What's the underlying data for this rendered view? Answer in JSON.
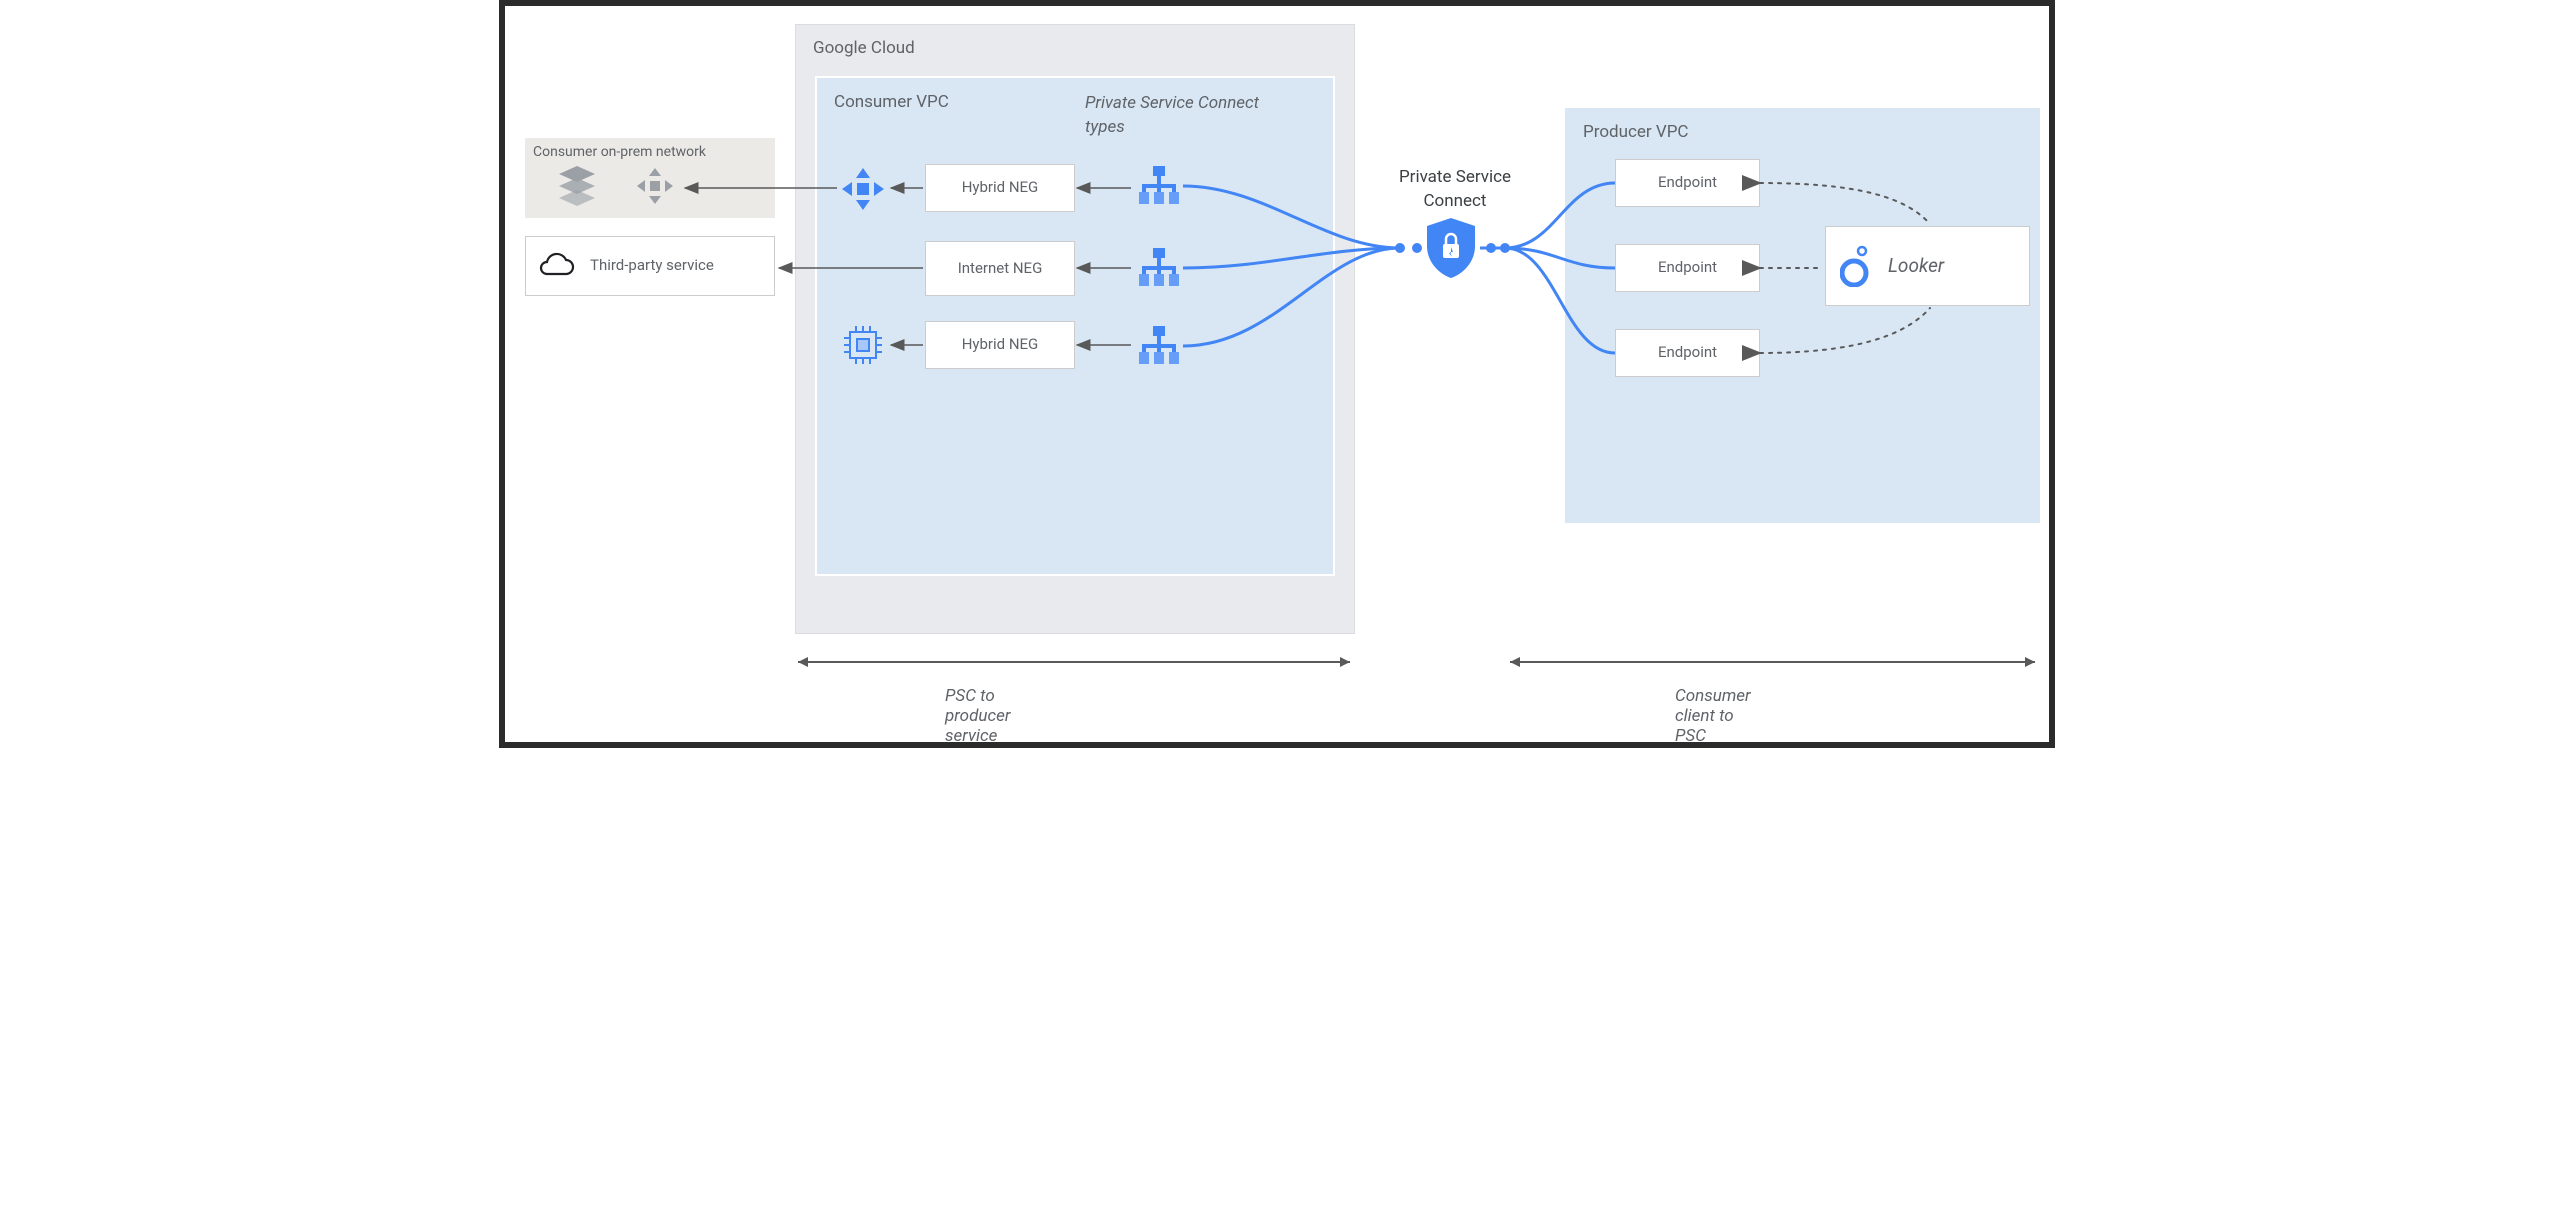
{
  "regions": {
    "googleCloud": "Google Cloud",
    "consumerVpc": "Consumer VPC",
    "producerVpc": "Producer VPC",
    "consumerOnPrem": "Consumer on-prem network"
  },
  "annotations": {
    "pscTypes": "Private Service Connect types",
    "pscCenter": "Private Service Connect",
    "leftSpan": "PSC to producer service",
    "rightSpan": "Consumer client to PSC"
  },
  "boxes": {
    "thirdParty": "Third-party service",
    "hybridNeg1": "Hybrid NEG",
    "internetNeg": "Internet NEG",
    "hybridNeg2": "Hybrid NEG",
    "endpoint1": "Endpoint",
    "endpoint2": "Endpoint",
    "endpoint3": "Endpoint",
    "looker": "Looker"
  },
  "icons": {
    "database": "database-icon",
    "hub": "hub-icon",
    "expand": "expand-arrows-icon",
    "lb": "load-balancer-icon",
    "cpu": "cpu-chip-icon",
    "shield": "security-shield-icon",
    "looker": "looker-icon",
    "cloud": "cloud-icon"
  }
}
